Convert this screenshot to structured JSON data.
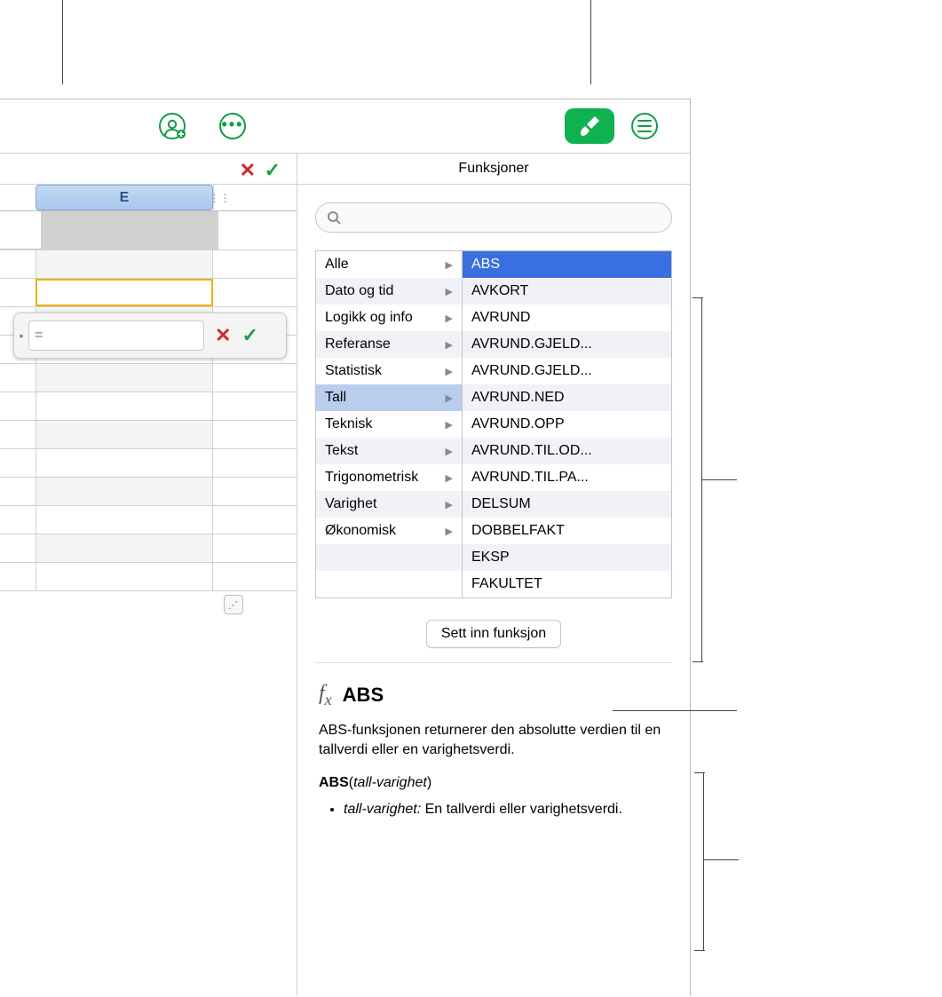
{
  "panel_title": "Funksjoner",
  "search_placeholder": "",
  "formula_editor": {
    "prefix": "=",
    "cancel": "✕",
    "accept": "✓"
  },
  "formula_bar": {
    "cancel": "✕",
    "accept": "✓"
  },
  "column_header": "E",
  "categories": [
    "Alle",
    "Dato og tid",
    "Logikk og info",
    "Referanse",
    "Statistisk",
    "Tall",
    "Teknisk",
    "Tekst",
    "Trigonometrisk",
    "Varighet",
    "Økonomisk"
  ],
  "selected_category_index": 5,
  "functions": [
    "ABS",
    "AVKORT",
    "AVRUND",
    "AVRUND.GJELD...",
    "AVRUND.GJELD...",
    "AVRUND.NED",
    "AVRUND.OPP",
    "AVRUND.TIL.OD...",
    "AVRUND.TIL.PA...",
    "DELSUM",
    "DOBBELFAKT",
    "EKSP",
    "FAKULTET"
  ],
  "selected_function_index": 0,
  "insert_button": "Sett inn funksjon",
  "help": {
    "fn_name": "ABS",
    "description": "ABS-funksjonen returnerer den absolutte verdien til en tallverdi eller en varighetsverdi.",
    "sig_fn": "ABS",
    "sig_arg": "tall-varighet",
    "args": [
      {
        "name": "tall-varighet:",
        "desc": "En tallverdi eller varighetsverdi."
      }
    ]
  }
}
